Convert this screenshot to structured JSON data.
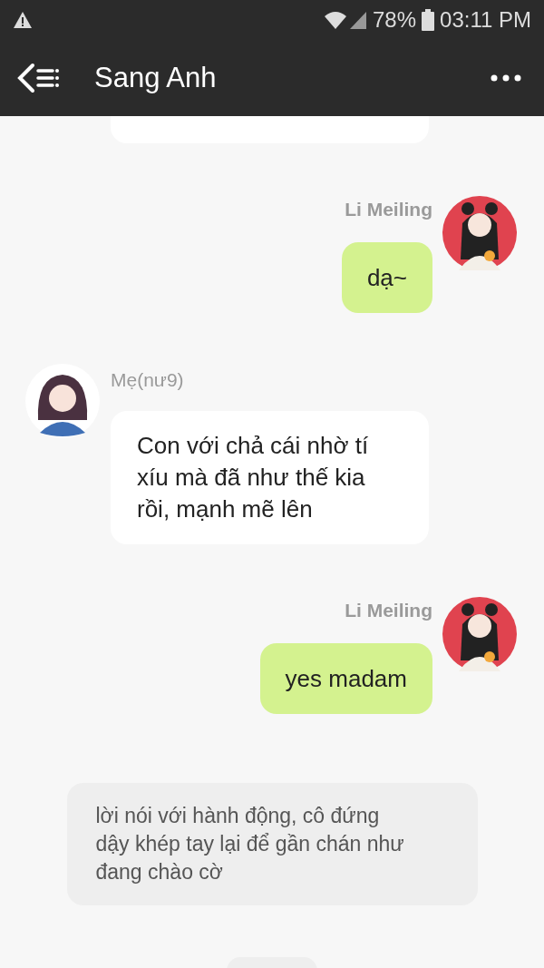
{
  "status_bar": {
    "battery": "78%",
    "time": "03:11 PM"
  },
  "header": {
    "title": "Sang Anh"
  },
  "messages": [
    {
      "kind": "hidden"
    },
    {
      "kind": "outgoing",
      "sender": "Li Meiling",
      "text": "dạ~"
    },
    {
      "kind": "incoming",
      "sender": "Mẹ(nư9)",
      "text": "Con với chả cái nhờ tí xíu mà đã như thế kia rồi, mạnh mẽ lên"
    },
    {
      "kind": "outgoing",
      "sender": "Li Meiling",
      "text": "yes madam"
    },
    {
      "kind": "narration",
      "text": "lời nói với hành động, cô đứng dậy khép tay lại để gần chán như đang chào cờ"
    }
  ]
}
